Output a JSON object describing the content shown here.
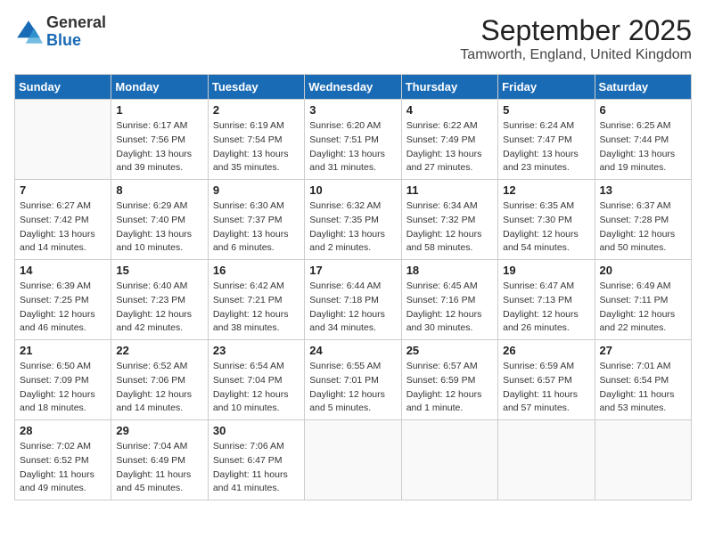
{
  "header": {
    "logo_general": "General",
    "logo_blue": "Blue",
    "title": "September 2025",
    "subtitle": "Tamworth, England, United Kingdom"
  },
  "weekdays": [
    "Sunday",
    "Monday",
    "Tuesday",
    "Wednesday",
    "Thursday",
    "Friday",
    "Saturday"
  ],
  "weeks": [
    [
      {
        "day": "",
        "sunrise": "",
        "sunset": "",
        "daylight": ""
      },
      {
        "day": "1",
        "sunrise": "Sunrise: 6:17 AM",
        "sunset": "Sunset: 7:56 PM",
        "daylight": "Daylight: 13 hours and 39 minutes."
      },
      {
        "day": "2",
        "sunrise": "Sunrise: 6:19 AM",
        "sunset": "Sunset: 7:54 PM",
        "daylight": "Daylight: 13 hours and 35 minutes."
      },
      {
        "day": "3",
        "sunrise": "Sunrise: 6:20 AM",
        "sunset": "Sunset: 7:51 PM",
        "daylight": "Daylight: 13 hours and 31 minutes."
      },
      {
        "day": "4",
        "sunrise": "Sunrise: 6:22 AM",
        "sunset": "Sunset: 7:49 PM",
        "daylight": "Daylight: 13 hours and 27 minutes."
      },
      {
        "day": "5",
        "sunrise": "Sunrise: 6:24 AM",
        "sunset": "Sunset: 7:47 PM",
        "daylight": "Daylight: 13 hours and 23 minutes."
      },
      {
        "day": "6",
        "sunrise": "Sunrise: 6:25 AM",
        "sunset": "Sunset: 7:44 PM",
        "daylight": "Daylight: 13 hours and 19 minutes."
      }
    ],
    [
      {
        "day": "7",
        "sunrise": "Sunrise: 6:27 AM",
        "sunset": "Sunset: 7:42 PM",
        "daylight": "Daylight: 13 hours and 14 minutes."
      },
      {
        "day": "8",
        "sunrise": "Sunrise: 6:29 AM",
        "sunset": "Sunset: 7:40 PM",
        "daylight": "Daylight: 13 hours and 10 minutes."
      },
      {
        "day": "9",
        "sunrise": "Sunrise: 6:30 AM",
        "sunset": "Sunset: 7:37 PM",
        "daylight": "Daylight: 13 hours and 6 minutes."
      },
      {
        "day": "10",
        "sunrise": "Sunrise: 6:32 AM",
        "sunset": "Sunset: 7:35 PM",
        "daylight": "Daylight: 13 hours and 2 minutes."
      },
      {
        "day": "11",
        "sunrise": "Sunrise: 6:34 AM",
        "sunset": "Sunset: 7:32 PM",
        "daylight": "Daylight: 12 hours and 58 minutes."
      },
      {
        "day": "12",
        "sunrise": "Sunrise: 6:35 AM",
        "sunset": "Sunset: 7:30 PM",
        "daylight": "Daylight: 12 hours and 54 minutes."
      },
      {
        "day": "13",
        "sunrise": "Sunrise: 6:37 AM",
        "sunset": "Sunset: 7:28 PM",
        "daylight": "Daylight: 12 hours and 50 minutes."
      }
    ],
    [
      {
        "day": "14",
        "sunrise": "Sunrise: 6:39 AM",
        "sunset": "Sunset: 7:25 PM",
        "daylight": "Daylight: 12 hours and 46 minutes."
      },
      {
        "day": "15",
        "sunrise": "Sunrise: 6:40 AM",
        "sunset": "Sunset: 7:23 PM",
        "daylight": "Daylight: 12 hours and 42 minutes."
      },
      {
        "day": "16",
        "sunrise": "Sunrise: 6:42 AM",
        "sunset": "Sunset: 7:21 PM",
        "daylight": "Daylight: 12 hours and 38 minutes."
      },
      {
        "day": "17",
        "sunrise": "Sunrise: 6:44 AM",
        "sunset": "Sunset: 7:18 PM",
        "daylight": "Daylight: 12 hours and 34 minutes."
      },
      {
        "day": "18",
        "sunrise": "Sunrise: 6:45 AM",
        "sunset": "Sunset: 7:16 PM",
        "daylight": "Daylight: 12 hours and 30 minutes."
      },
      {
        "day": "19",
        "sunrise": "Sunrise: 6:47 AM",
        "sunset": "Sunset: 7:13 PM",
        "daylight": "Daylight: 12 hours and 26 minutes."
      },
      {
        "day": "20",
        "sunrise": "Sunrise: 6:49 AM",
        "sunset": "Sunset: 7:11 PM",
        "daylight": "Daylight: 12 hours and 22 minutes."
      }
    ],
    [
      {
        "day": "21",
        "sunrise": "Sunrise: 6:50 AM",
        "sunset": "Sunset: 7:09 PM",
        "daylight": "Daylight: 12 hours and 18 minutes."
      },
      {
        "day": "22",
        "sunrise": "Sunrise: 6:52 AM",
        "sunset": "Sunset: 7:06 PM",
        "daylight": "Daylight: 12 hours and 14 minutes."
      },
      {
        "day": "23",
        "sunrise": "Sunrise: 6:54 AM",
        "sunset": "Sunset: 7:04 PM",
        "daylight": "Daylight: 12 hours and 10 minutes."
      },
      {
        "day": "24",
        "sunrise": "Sunrise: 6:55 AM",
        "sunset": "Sunset: 7:01 PM",
        "daylight": "Daylight: 12 hours and 5 minutes."
      },
      {
        "day": "25",
        "sunrise": "Sunrise: 6:57 AM",
        "sunset": "Sunset: 6:59 PM",
        "daylight": "Daylight: 12 hours and 1 minute."
      },
      {
        "day": "26",
        "sunrise": "Sunrise: 6:59 AM",
        "sunset": "Sunset: 6:57 PM",
        "daylight": "Daylight: 11 hours and 57 minutes."
      },
      {
        "day": "27",
        "sunrise": "Sunrise: 7:01 AM",
        "sunset": "Sunset: 6:54 PM",
        "daylight": "Daylight: 11 hours and 53 minutes."
      }
    ],
    [
      {
        "day": "28",
        "sunrise": "Sunrise: 7:02 AM",
        "sunset": "Sunset: 6:52 PM",
        "daylight": "Daylight: 11 hours and 49 minutes."
      },
      {
        "day": "29",
        "sunrise": "Sunrise: 7:04 AM",
        "sunset": "Sunset: 6:49 PM",
        "daylight": "Daylight: 11 hours and 45 minutes."
      },
      {
        "day": "30",
        "sunrise": "Sunrise: 7:06 AM",
        "sunset": "Sunset: 6:47 PM",
        "daylight": "Daylight: 11 hours and 41 minutes."
      },
      {
        "day": "",
        "sunrise": "",
        "sunset": "",
        "daylight": ""
      },
      {
        "day": "",
        "sunrise": "",
        "sunset": "",
        "daylight": ""
      },
      {
        "day": "",
        "sunrise": "",
        "sunset": "",
        "daylight": ""
      },
      {
        "day": "",
        "sunrise": "",
        "sunset": "",
        "daylight": ""
      }
    ]
  ]
}
